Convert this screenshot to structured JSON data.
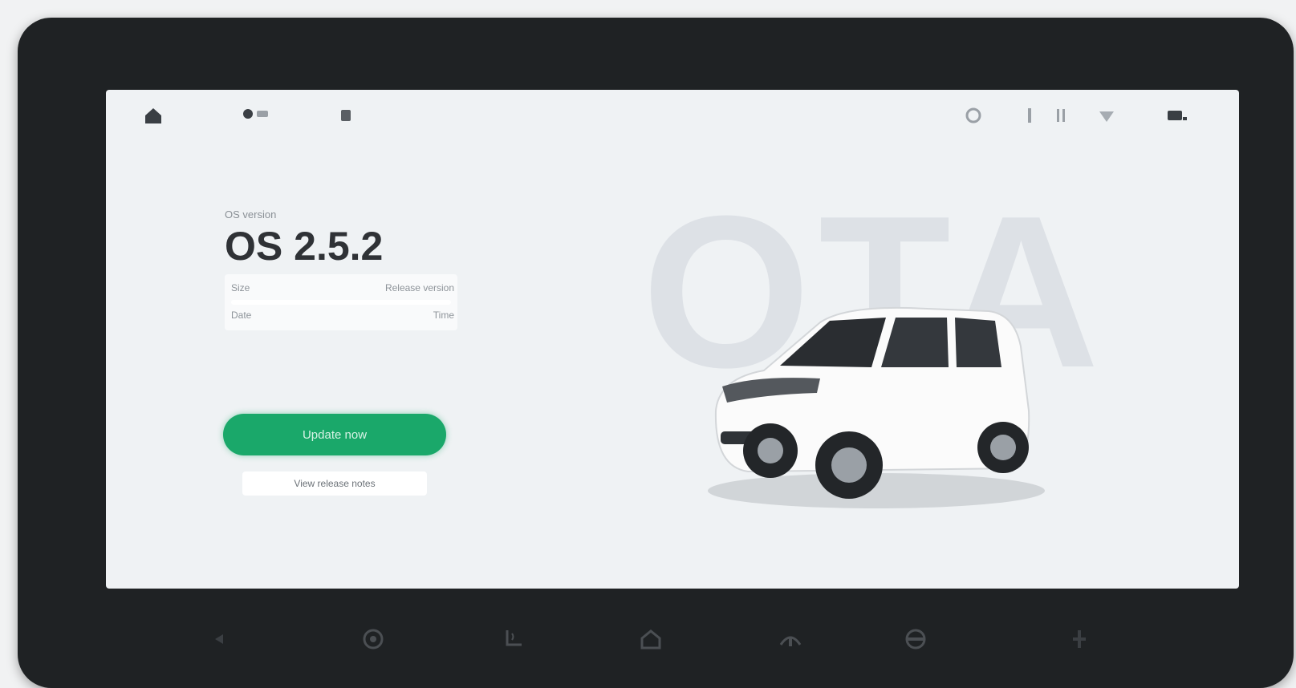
{
  "screen": {
    "watermark": "OTA",
    "version_label": "OS version",
    "version_number": "OS 2.5.2",
    "info_rows": [
      {
        "key": "Size",
        "value": "Release version"
      },
      {
        "key": "Date",
        "value": "Time"
      }
    ],
    "update_button_label": "Update now",
    "release_notes_label": "View release notes"
  },
  "status_bar": {
    "left_icons": [
      "home-icon",
      "profile-icon",
      "menu-icon"
    ],
    "right_icons": [
      "settings-icon",
      "bluetooth-icon",
      "signal-icon",
      "wifi-icon",
      "battery-icon"
    ]
  },
  "nav_bar": {
    "icons": [
      "back-icon",
      "fan-icon",
      "seat-heat-icon",
      "home-icon",
      "defrost-icon",
      "steering-icon",
      "volume-icon"
    ]
  },
  "colors": {
    "accent": "#1aa86a",
    "frame": "#1f2224",
    "screen_bg": "#eff2f4",
    "watermark": "#dde1e6"
  }
}
